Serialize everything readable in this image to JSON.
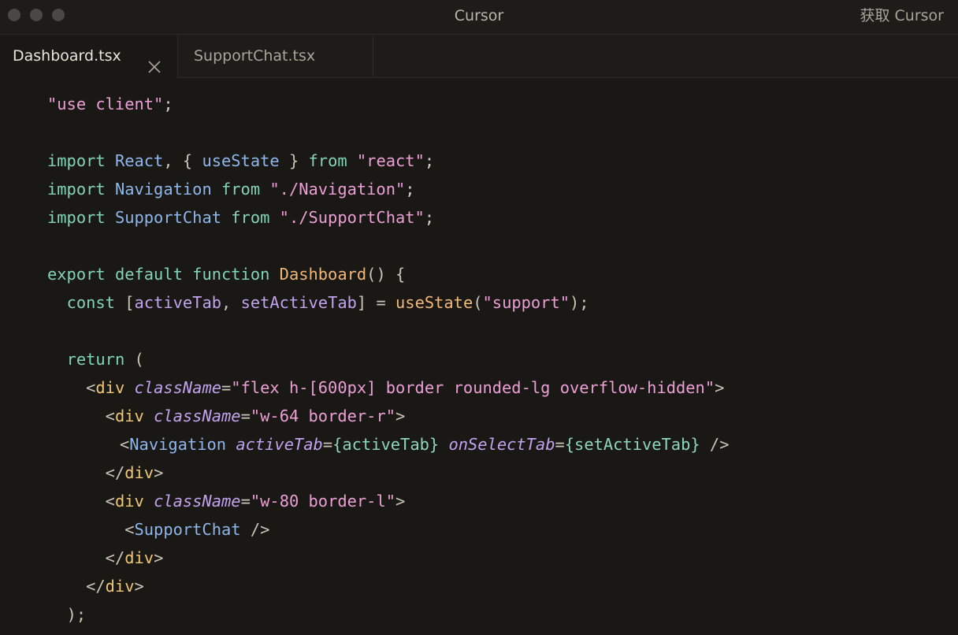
{
  "window": {
    "title": "Cursor",
    "get_cursor_label": "获取 Cursor"
  },
  "tabs": [
    {
      "label": "Dashboard.tsx",
      "active": true
    },
    {
      "label": "SupportChat.tsx",
      "active": false
    }
  ],
  "icons": {
    "close_tab": "close-icon"
  },
  "code": {
    "l1": {
      "s1": "\"use client\"",
      "p1": ";"
    },
    "l3": {
      "k1": "import",
      "i1": "React",
      "p1": ", { ",
      "i2": "useState",
      "p2": " } ",
      "k2": "from",
      "s1": "\"react\"",
      "p3": ";"
    },
    "l4": {
      "k1": "import",
      "i1": "Navigation",
      "k2": "from",
      "s1": "\"./Navigation\"",
      "p1": ";"
    },
    "l5": {
      "k1": "import",
      "i1": "SupportChat",
      "k2": "from",
      "s1": "\"./SupportChat\"",
      "p1": ";"
    },
    "l7": {
      "k1": "export",
      "k2": "default",
      "k3": "function",
      "f1": "Dashboard",
      "p1": "() {"
    },
    "l8": {
      "k1": "const",
      "p1": "[",
      "i1": "activeTab",
      "p2": ", ",
      "i2": "setActiveTab",
      "p3": "] = ",
      "f1": "useState",
      "p4": "(",
      "s1": "\"support\"",
      "p5": ");"
    },
    "l10": {
      "k1": "return",
      "p1": "("
    },
    "l11": {
      "p1": "<",
      "t1": "div",
      "a1": "className",
      "p2": "=",
      "s1": "\"flex h-[600px] border rounded-lg overflow-hidden\"",
      "p3": ">"
    },
    "l12": {
      "p1": "<",
      "t1": "div",
      "a1": "className",
      "p2": "=",
      "s1": "\"w-64 border-r\"",
      "p3": ">"
    },
    "l13": {
      "p1": "<",
      "i1": "Navigation",
      "a1": "activeTab",
      "p2": "=",
      "b1": "{activeTab}",
      "a2": "onSelectTab",
      "p3": "=",
      "b2": "{setActiveTab}",
      "p4": "/>"
    },
    "l14": {
      "p1": "</",
      "t1": "div",
      "p2": ">"
    },
    "l15": {
      "p1": "<",
      "t1": "div",
      "a1": "className",
      "p2": "=",
      "s1": "\"w-80 border-l\"",
      "p3": ">"
    },
    "l16": {
      "p1": "<",
      "i1": "SupportChat",
      "p2": "/>"
    },
    "l17": {
      "p1": "</",
      "t1": "div",
      "p2": ">"
    },
    "l18": {
      "p1": "</",
      "t1": "div",
      "p2": ">"
    },
    "l19": {
      "p1": ");"
    }
  }
}
